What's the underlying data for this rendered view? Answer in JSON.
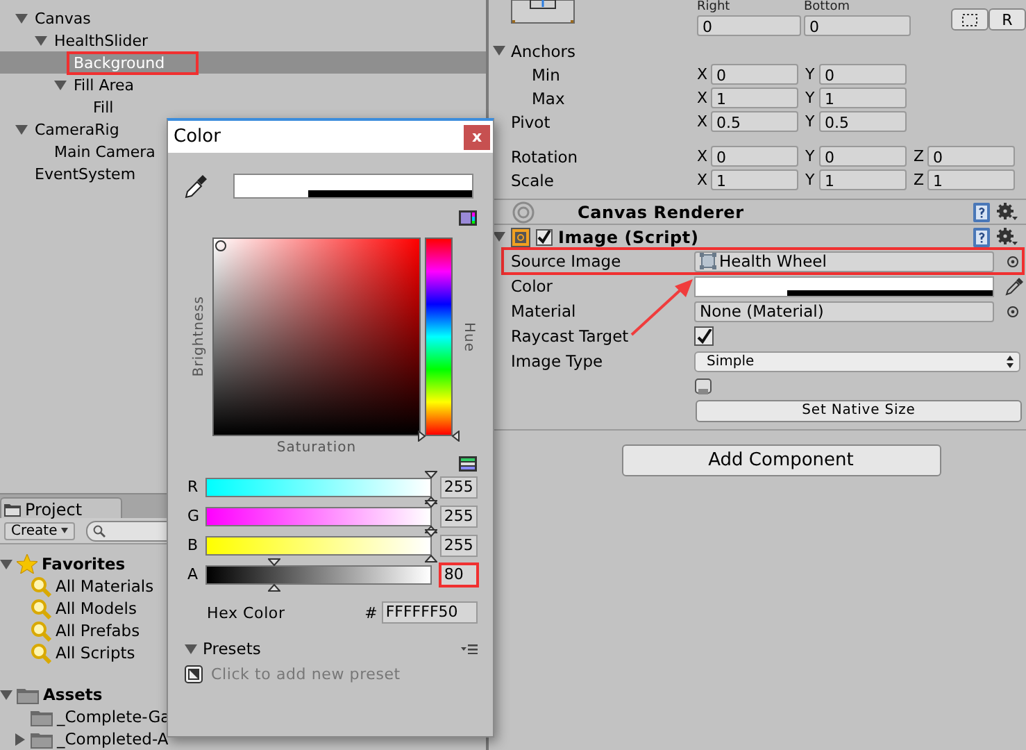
{
  "hierarchy": {
    "items": [
      {
        "label": "Canvas",
        "expanded": true,
        "selected": false,
        "highlighted": false,
        "children": [
          {
            "label": "HealthSlider",
            "expanded": true,
            "selected": false,
            "highlighted": false,
            "children": [
              {
                "label": "Background",
                "selected": true,
                "highlighted": true
              },
              {
                "label": "Fill Area",
                "expanded": true,
                "selected": false,
                "highlighted": false,
                "children": [
                  {
                    "label": "Fill",
                    "selected": false,
                    "highlighted": false
                  }
                ]
              }
            ]
          }
        ]
      },
      {
        "label": "CameraRig",
        "expanded": true,
        "selected": false,
        "highlighted": false,
        "children": [
          {
            "label": "Main Camera",
            "selected": false,
            "highlighted": false
          }
        ]
      },
      {
        "label": "EventSystem",
        "selected": false,
        "highlighted": false
      }
    ]
  },
  "project": {
    "tab": "Project",
    "create_button": "Create",
    "favorites": {
      "label": "Favorites",
      "expanded": true,
      "items": [
        "All Materials",
        "All Models",
        "All Prefabs",
        "All Scripts"
      ]
    },
    "assets": {
      "label": "Assets",
      "expanded": true,
      "items": [
        {
          "label": "_Complete-Ga"
        },
        {
          "label": "_Completed-A",
          "expanded": false
        }
      ]
    }
  },
  "inspector": {
    "offset_fields": [
      {
        "label": "Right",
        "value": "0"
      },
      {
        "label": "Bottom",
        "value": "0"
      }
    ],
    "raw_edit_button": "R",
    "anchors": {
      "label": "Anchors",
      "expanded": true,
      "rows": [
        {
          "label": "Min",
          "fields": [
            {
              "axis": "X",
              "value": "0"
            },
            {
              "axis": "Y",
              "value": "0"
            }
          ]
        },
        {
          "label": "Max",
          "fields": [
            {
              "axis": "X",
              "value": "1"
            },
            {
              "axis": "Y",
              "value": "1"
            }
          ]
        }
      ]
    },
    "pivot": {
      "label": "Pivot",
      "fields": [
        {
          "axis": "X",
          "value": "0.5"
        },
        {
          "axis": "Y",
          "value": "0.5"
        }
      ]
    },
    "transform": [
      {
        "label": "Rotation",
        "fields": [
          {
            "axis": "X",
            "value": "0"
          },
          {
            "axis": "Y",
            "value": "0"
          },
          {
            "axis": "Z",
            "value": "0"
          }
        ]
      },
      {
        "label": "Scale",
        "fields": [
          {
            "axis": "X",
            "value": "1"
          },
          {
            "axis": "Y",
            "value": "1"
          },
          {
            "axis": "Z",
            "value": "1"
          }
        ]
      }
    ],
    "components": [
      {
        "kind": "canvas_renderer",
        "title": "Canvas Renderer"
      },
      {
        "kind": "image",
        "title": "Image (Script)",
        "enabled": true,
        "expanded": true,
        "properties": [
          {
            "kind": "object",
            "label": "Source Image",
            "value": "Health Wheel",
            "highlighted": true
          },
          {
            "kind": "color",
            "label": "Color",
            "level": 0.31,
            "highlighted": false
          },
          {
            "kind": "object",
            "label": "Material",
            "value": "None (Material)",
            "highlighted": false
          },
          {
            "kind": "checkbox",
            "label": "Raycast Target",
            "checked": true,
            "highlighted": false
          },
          {
            "kind": "dropdown",
            "label": "Image Type",
            "value": "Simple",
            "highlighted": false
          },
          {
            "kind": "sprite_icon",
            "highlighted": false
          },
          {
            "kind": "button",
            "value": "Set Native Size",
            "highlighted": false
          }
        ]
      }
    ],
    "add_component_button": "Add Component"
  },
  "color_dialog": {
    "title": "Color",
    "close": "x",
    "preview": {
      "level": 0.31
    },
    "hue": {
      "level": 0
    },
    "brightness_label": "Brightness",
    "saturation_label": "Saturation",
    "hue_label": "Hue",
    "channels": [
      {
        "name": "R",
        "color": "#00ffff",
        "level": 1,
        "value": "255",
        "highlighted": false
      },
      {
        "name": "G",
        "color": "#ff00ff",
        "level": 1,
        "value": "255",
        "highlighted": false
      },
      {
        "name": "B",
        "color": "#ffff00",
        "level": 1,
        "value": "255",
        "highlighted": false
      },
      {
        "name": "A",
        "color": "#000000",
        "level": 0.31,
        "value": "80",
        "highlighted": true
      }
    ],
    "hex": {
      "label": "Hex Color",
      "prefix": "#",
      "value": "FFFFFF50"
    },
    "presets": {
      "label": "Presets",
      "expanded": true,
      "add_hint": "Click to add new preset"
    }
  }
}
